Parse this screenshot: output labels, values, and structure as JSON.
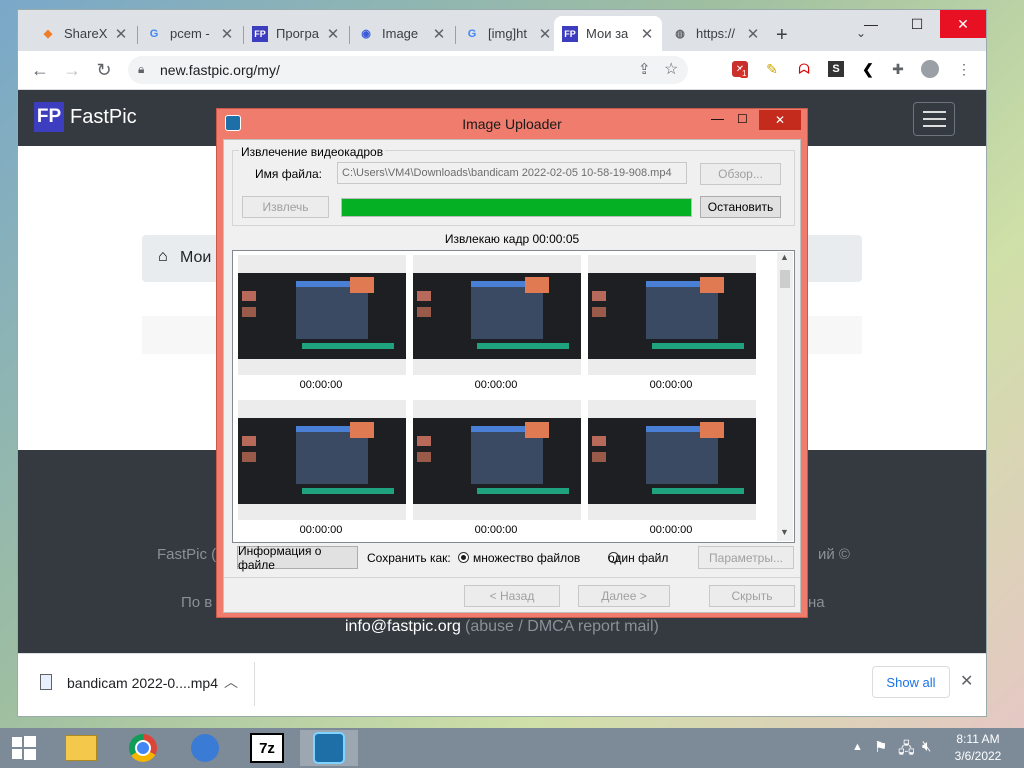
{
  "browser": {
    "tabs": [
      {
        "title": "ShareX",
        "icon": "sharex-icon",
        "color": "#f07c28"
      },
      {
        "title": "pcem -",
        "icon": "google-icon",
        "color": "#4285f4"
      },
      {
        "title": "Програ",
        "icon": "fastpic-icon",
        "color": "#3d3dbf"
      },
      {
        "title": "Image",
        "icon": "blue-globe-icon",
        "color": "#3b5bdb"
      },
      {
        "title": "[img]ht",
        "icon": "google-icon",
        "color": "#4285f4"
      },
      {
        "title": "Мои за",
        "icon": "fastpic-icon",
        "color": "#3d3dbf"
      },
      {
        "title": "https://",
        "icon": "globe-icon",
        "color": "#5f6368"
      }
    ],
    "url": "new.fastpic.org/my/",
    "extension_badge": "1"
  },
  "page": {
    "logo_letters": "FP",
    "logo_text": "FastPic",
    "breadcrumb": "Мои",
    "footer_left": "FastPic (",
    "footer_right": "ий ©",
    "footer_line2_left": "По в",
    "footer_line2_right": "на",
    "footer_email": "info@fastpic.org",
    "footer_email_note": "(abuse / DMCA report mail)"
  },
  "download": {
    "filename": "bandicam 2022-0....mp4",
    "show_all": "Show all"
  },
  "dialog": {
    "title": "Image Uploader",
    "group_title": "Извлечение видеокадров",
    "file_label": "Имя файла:",
    "file_value": "C:\\Users\\VM4\\Downloads\\bandicam 2022-02-05 10-58-19-908.mp4",
    "browse": "Обзор...",
    "extract": "Извлечь",
    "stop": "Остановить",
    "progress": 1.0,
    "status": "Извлекаю кадр 00:00:05",
    "frames": [
      "00:00:00",
      "00:00:00",
      "00:00:00",
      "00:00:00",
      "00:00:00",
      "00:00:00"
    ],
    "file_info": "Информация о файле",
    "save_as": "Сохранить как:",
    "opt_multi": "множество файлов",
    "opt_single": "один файл",
    "params": "Параметры...",
    "back": "< Назад",
    "next": "Далее >",
    "hide": "Скрыть"
  },
  "taskbar": {
    "time": "8:11 AM",
    "date": "3/6/2022",
    "sevenzip": "7z"
  },
  "colors": {
    "dialog_frame": "#f07c6d",
    "progress_fill": "#06b025",
    "navbar": "#343a40",
    "close_red": "#e81123"
  }
}
